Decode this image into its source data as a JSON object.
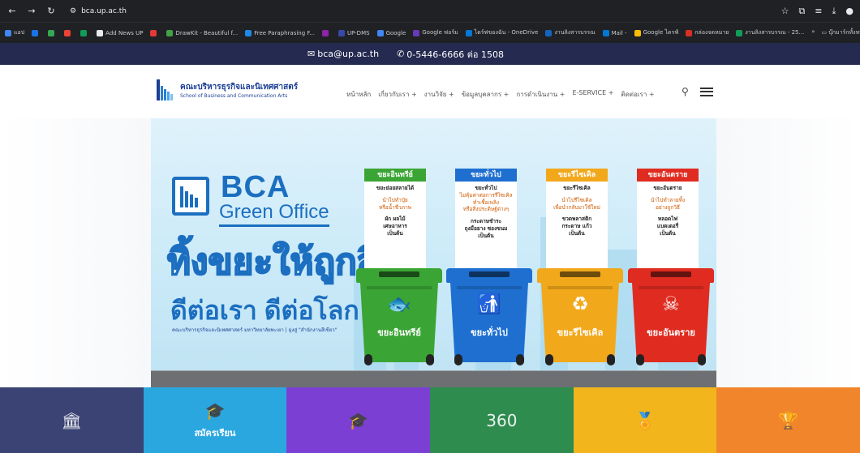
{
  "browser": {
    "url": "bca.up.ac.th",
    "bookmarks": [
      {
        "label": "แอป",
        "color": "#4285f4"
      },
      {
        "label": "",
        "color": "#1a73e8"
      },
      {
        "label": "",
        "color": "#34a853"
      },
      {
        "label": "",
        "color": "#ea4335"
      },
      {
        "label": "",
        "color": "#0f9d58"
      },
      {
        "label": "Add News UP",
        "color": "#e8eaed"
      },
      {
        "label": "",
        "color": "#e53935"
      },
      {
        "label": "DrawKit - Beautiful f...",
        "color": "#43a047"
      },
      {
        "label": "Free Paraphrasing F...",
        "color": "#1e88e5"
      },
      {
        "label": "",
        "color": "#8e24aa"
      },
      {
        "label": "UP-DMS",
        "color": "#3949ab"
      },
      {
        "label": "Google",
        "color": "#4285f4"
      },
      {
        "label": "Google ฟอร์ม",
        "color": "#673ab7"
      },
      {
        "label": "ไดร์ฟของฉัน - OneDrive",
        "color": "#0078d4"
      },
      {
        "label": "งานลิงสารบรรณ",
        "color": "#1565c0"
      },
      {
        "label": "Mail -",
        "color": "#0078d4"
      },
      {
        "label": "Google ไดรฟ์",
        "color": "#fbbc04"
      },
      {
        "label": "กล่องจดหมาย",
        "color": "#d93025"
      },
      {
        "label": "งานลิงสารบรรณ - 25...",
        "color": "#0f9d58"
      }
    ],
    "bookmarks_more": "»",
    "bookmarks_folder": "บุ๊กมาร์กทั้งหมด"
  },
  "contact": {
    "email": "bca@up.ac.th",
    "phone": "0-5446-6666 ต่อ 1508"
  },
  "header": {
    "logo_th": "คณะบริหารธุรกิจและนิเทศศาสตร์",
    "logo_en": "School of Business and Communication Arts",
    "menu": [
      "หน้าหลัก",
      "เกี่ยวกับเรา +",
      "งานวิจัย +",
      "ข้อมูลบุคลากร +",
      "การดำเนินงาน +",
      "E-SERVICE +",
      "ติดต่อเรา +"
    ]
  },
  "hero": {
    "bca": "BCA",
    "green_office": "Green Office",
    "slogan1": "ทิ้งขยะให้ถูกสี",
    "slogan2": "ดีต่อเรา ดีต่อโลก",
    "caption": "คณะบริหารธุรกิจและนิเทศศาสตร์ มหาวิทยาลัยพะเยา | มุ่งสู่ \"สำนักงานสีเขียว\"",
    "bins": [
      {
        "tag": "ขยะอินทรีย์",
        "color": "#3aa534",
        "lines": [
          "ขยะย่อยสลายได้",
          "",
          "นำไปทำปุ๋ย",
          "หรือน้ำชีวภาพ",
          "",
          "ผัก ผลไม้",
          "เศษอาหาร",
          "เป็นต้น"
        ],
        "can_label": "ขยะอินทรีย์",
        "can_icon": "🐟"
      },
      {
        "tag": "ขยะทั่วไป",
        "color": "#1e6fd0",
        "lines": [
          "ขยะทั่วไป",
          "ไม่คุ้มค่าต่อการรีไซเคิล",
          "ทำเชื้อเพลิง",
          "หรือสิ่งประดิษฐ์ต่างๆ",
          "",
          "กระดาษชำระ",
          "ถุงมือยาง ซองขนม",
          "เป็นต้น"
        ],
        "can_label": "ขยะทั่วไป",
        "can_icon": "🚮"
      },
      {
        "tag": "ขยะรีไซเคิล",
        "color": "#f2a81b",
        "lines": [
          "ขยะรีไซเคิล",
          "",
          "นำไปรีไซเคิล",
          "เพื่อนำกลับมาใช้ใหม่",
          "",
          "ขวดพลาสติก",
          "กระดาษ แก้ว",
          "เป็นต้น"
        ],
        "can_label": "ขยะรีไซเคิล",
        "can_icon": "♻"
      },
      {
        "tag": "ขยะอันตราย",
        "color": "#e02b20",
        "lines": [
          "ขยะอันตราย",
          "",
          "นำไปทำลายทิ้ง",
          "อย่างถูกวิธี",
          "",
          "หลอดไฟ",
          "แบตเตอรี่",
          "เป็นต้น"
        ],
        "can_label": "ขยะอันตราย",
        "can_icon": "☠"
      }
    ]
  },
  "tiles": [
    {
      "label": "",
      "icon": "🏛",
      "color": "#3a4373"
    },
    {
      "label": "สมัครเรียน",
      "icon": "🎓",
      "color": "#2ba7df"
    },
    {
      "label": "",
      "icon": "🎓",
      "color": "#7b3fd4"
    },
    {
      "label": "",
      "icon": "360",
      "color": "#2e8c4f"
    },
    {
      "label": "",
      "icon": "🏅",
      "color": "#f2b51b"
    },
    {
      "label": "",
      "icon": "🏆",
      "color": "#f0852b"
    }
  ]
}
